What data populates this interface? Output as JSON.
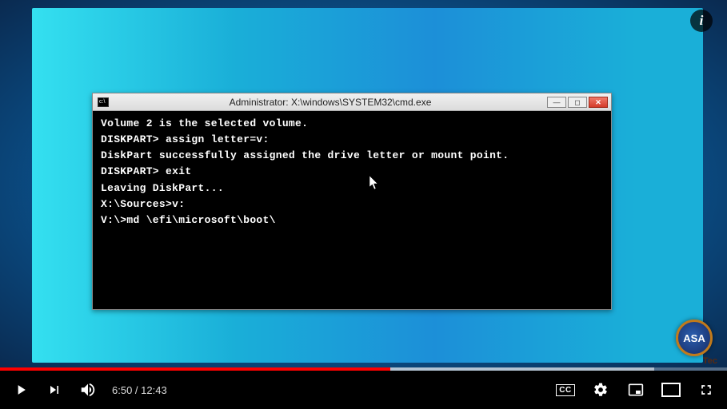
{
  "player": {
    "info_label": "i",
    "progress": {
      "played_pct": 53.7,
      "loaded_pct": 90
    },
    "time": {
      "current": "6:50",
      "separator": " / ",
      "duration": "12:43"
    },
    "cc_label": "CC"
  },
  "cmd": {
    "title": "Administrator: X:\\windows\\SYSTEM32\\cmd.exe",
    "lines": [
      "Volume 2 is the selected volume.",
      "DISKPART> assign letter=v:",
      "DiskPart successfully assigned the drive letter or mount point.",
      "DISKPART> exit",
      "Leaving DiskPart...",
      "X:\\Sources>v:",
      "V:\\>md \\efi\\microsoft\\boot\\"
    ]
  },
  "watermark": {
    "text": "ASA",
    "sub": "Tec"
  }
}
